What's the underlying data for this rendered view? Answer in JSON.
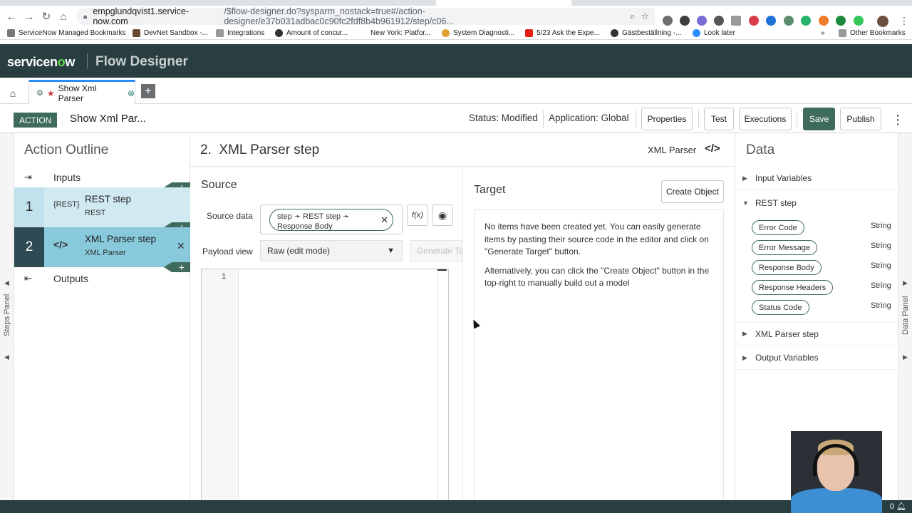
{
  "browser": {
    "url_host": "empglundqvist1.service-now.com",
    "url_path": "/$flow-designer.do?sysparm_nostack=true#/action-designer/e37b031adbac0c90fc2fdf8b4b961912/step/c06...",
    "bookmarks": [
      "ServiceNow Managed Bookmarks",
      "DevNet Sandbox -...",
      "Integrations",
      "Amount of concur...",
      "New York: Platfor...",
      "System Diagnosti...",
      "5/23 Ask the Expe...",
      "Gästbeställning -...",
      "Look later",
      "Other Bookmarks"
    ]
  },
  "header": {
    "logo_pre": "servicen",
    "logo_o": "o",
    "logo_post": "w",
    "app_title": "Flow Designer"
  },
  "tabs": {
    "active_tab_label": "Show Xml Parser",
    "add_label": "+"
  },
  "action_bar": {
    "badge": "ACTION",
    "action_name": "Show Xml Par...",
    "status": "Status: Modified",
    "application": "Application: Global",
    "buttons": {
      "properties": "Properties",
      "test": "Test",
      "executions": "Executions",
      "save": "Save",
      "publish": "Publish"
    }
  },
  "outline": {
    "title": "Action Outline",
    "inputs": "Inputs",
    "outputs": "Outputs",
    "steps": [
      {
        "num": "1",
        "icon": "{REST}",
        "title": "REST step",
        "sub": "REST"
      },
      {
        "num": "2",
        "icon": "</>",
        "title": "XML Parser step",
        "sub": "XML Parser"
      }
    ],
    "steps_panel_label": "Steps Panel"
  },
  "step": {
    "heading_num": "2.",
    "heading": "XML Parser step",
    "type_label": "XML Parser"
  },
  "source": {
    "title": "Source",
    "source_data_label": "Source data",
    "pill_text": "step ➛ REST step ➛ Response Body",
    "fx_label": "f(x)",
    "payload_label": "Payload view",
    "payload_value": "Raw (edit mode)",
    "generate_label": "Generate Target",
    "line_number": "1"
  },
  "target": {
    "title": "Target",
    "create_label": "Create Object",
    "message1": "No items have been created yet. You can easily generate items by pasting their source code in the editor and click on \"Generate Target\" button.",
    "message2": "Alternatively, you can click the \"Create Object\" button in the top-right to manually build out a model"
  },
  "data_panel": {
    "title": "Data",
    "sections": {
      "input_variables": "Input Variables",
      "rest_step": "REST step",
      "xml_parser_step": "XML Parser step",
      "output_variables": "Output Variables"
    },
    "rest_vars": [
      {
        "name": "Error Code",
        "type": "String"
      },
      {
        "name": "Error Message",
        "type": "String"
      },
      {
        "name": "Response Body",
        "type": "String"
      },
      {
        "name": "Response Headers",
        "type": "String"
      },
      {
        "name": "Status Code",
        "type": "String"
      }
    ],
    "data_panel_label": "Data Panel"
  },
  "footer": {
    "notifications": "0"
  },
  "colors": {
    "header_bg": "#293e40",
    "accent_green": "#3e6b5c",
    "step_selected": "#88c9dc",
    "step_unselected": "#d1eaf2"
  }
}
